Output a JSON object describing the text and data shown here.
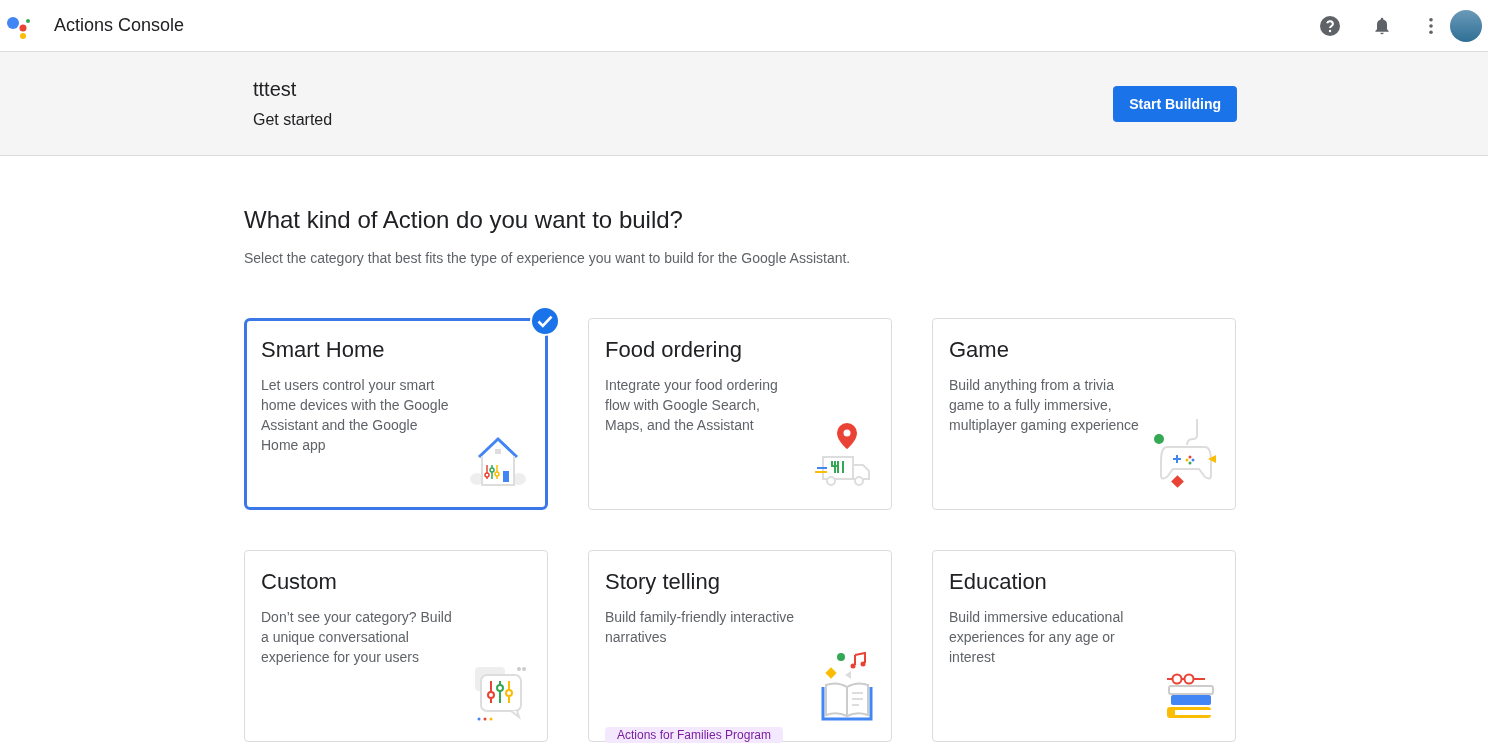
{
  "app_bar": {
    "title": "Actions Console"
  },
  "banner": {
    "project": "tttest",
    "subtitle": "Get started",
    "button": "Start Building"
  },
  "heading": "What kind of Action do you want to build?",
  "description": "Select the category that best fits the type of experience you want to build for the Google Assistant.",
  "categories": [
    {
      "kind": "home",
      "title": "Smart Home",
      "text": "Let users control your smart home devices with the Google Assistant and the Google Home app",
      "selected": true
    },
    {
      "kind": "food",
      "title": "Food ordering",
      "text": "Integrate your food ordering flow with Google Search, Maps, and the Assistant",
      "selected": false
    },
    {
      "kind": "game",
      "title": "Game",
      "text": "Build anything from a trivia game to a fully immersive, multiplayer gaming experience",
      "selected": false
    },
    {
      "kind": "custom",
      "title": "Custom",
      "text": "Don’t see your category? Build a unique conversational experience for your users",
      "selected": false
    },
    {
      "kind": "story",
      "title": "Story telling",
      "text": "Build family-friendly interactive narratives",
      "selected": false,
      "tag": "Actions for Families Program"
    },
    {
      "kind": "education",
      "title": "Education",
      "text": "Build immersive educational experiences for any age or interest",
      "selected": false
    }
  ]
}
